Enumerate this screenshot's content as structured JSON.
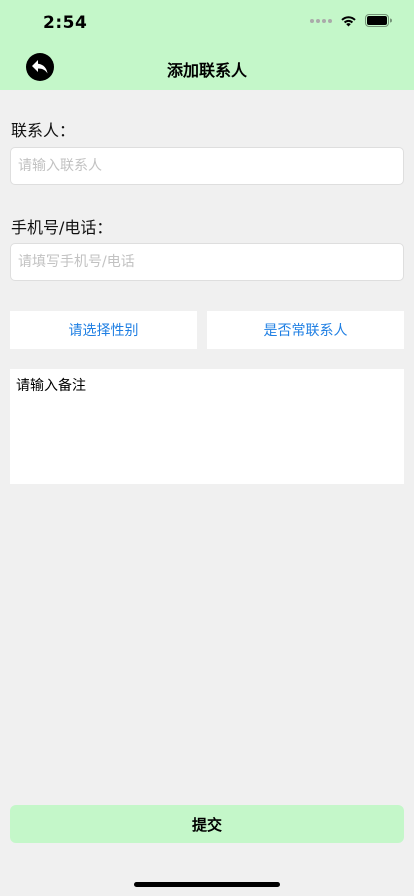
{
  "status_bar": {
    "time": "2:54"
  },
  "nav": {
    "title": "添加联系人"
  },
  "form": {
    "contact_label": "联系人：",
    "contact_placeholder": "请输入联系人",
    "phone_label": "手机号/电话：",
    "phone_placeholder": "请填写手机号/电话",
    "gender_button": "请选择性别",
    "frequent_button": "是否常联系人",
    "remark_placeholder": "请输入备注",
    "submit_label": "提交"
  },
  "colors": {
    "header_bg": "#c4f7c9",
    "page_bg": "#f0f0f0",
    "link_blue": "#1f7fe3"
  },
  "icons": {
    "back": "reply-arrow-icon",
    "wifi": "wifi-icon",
    "battery": "battery-icon"
  }
}
